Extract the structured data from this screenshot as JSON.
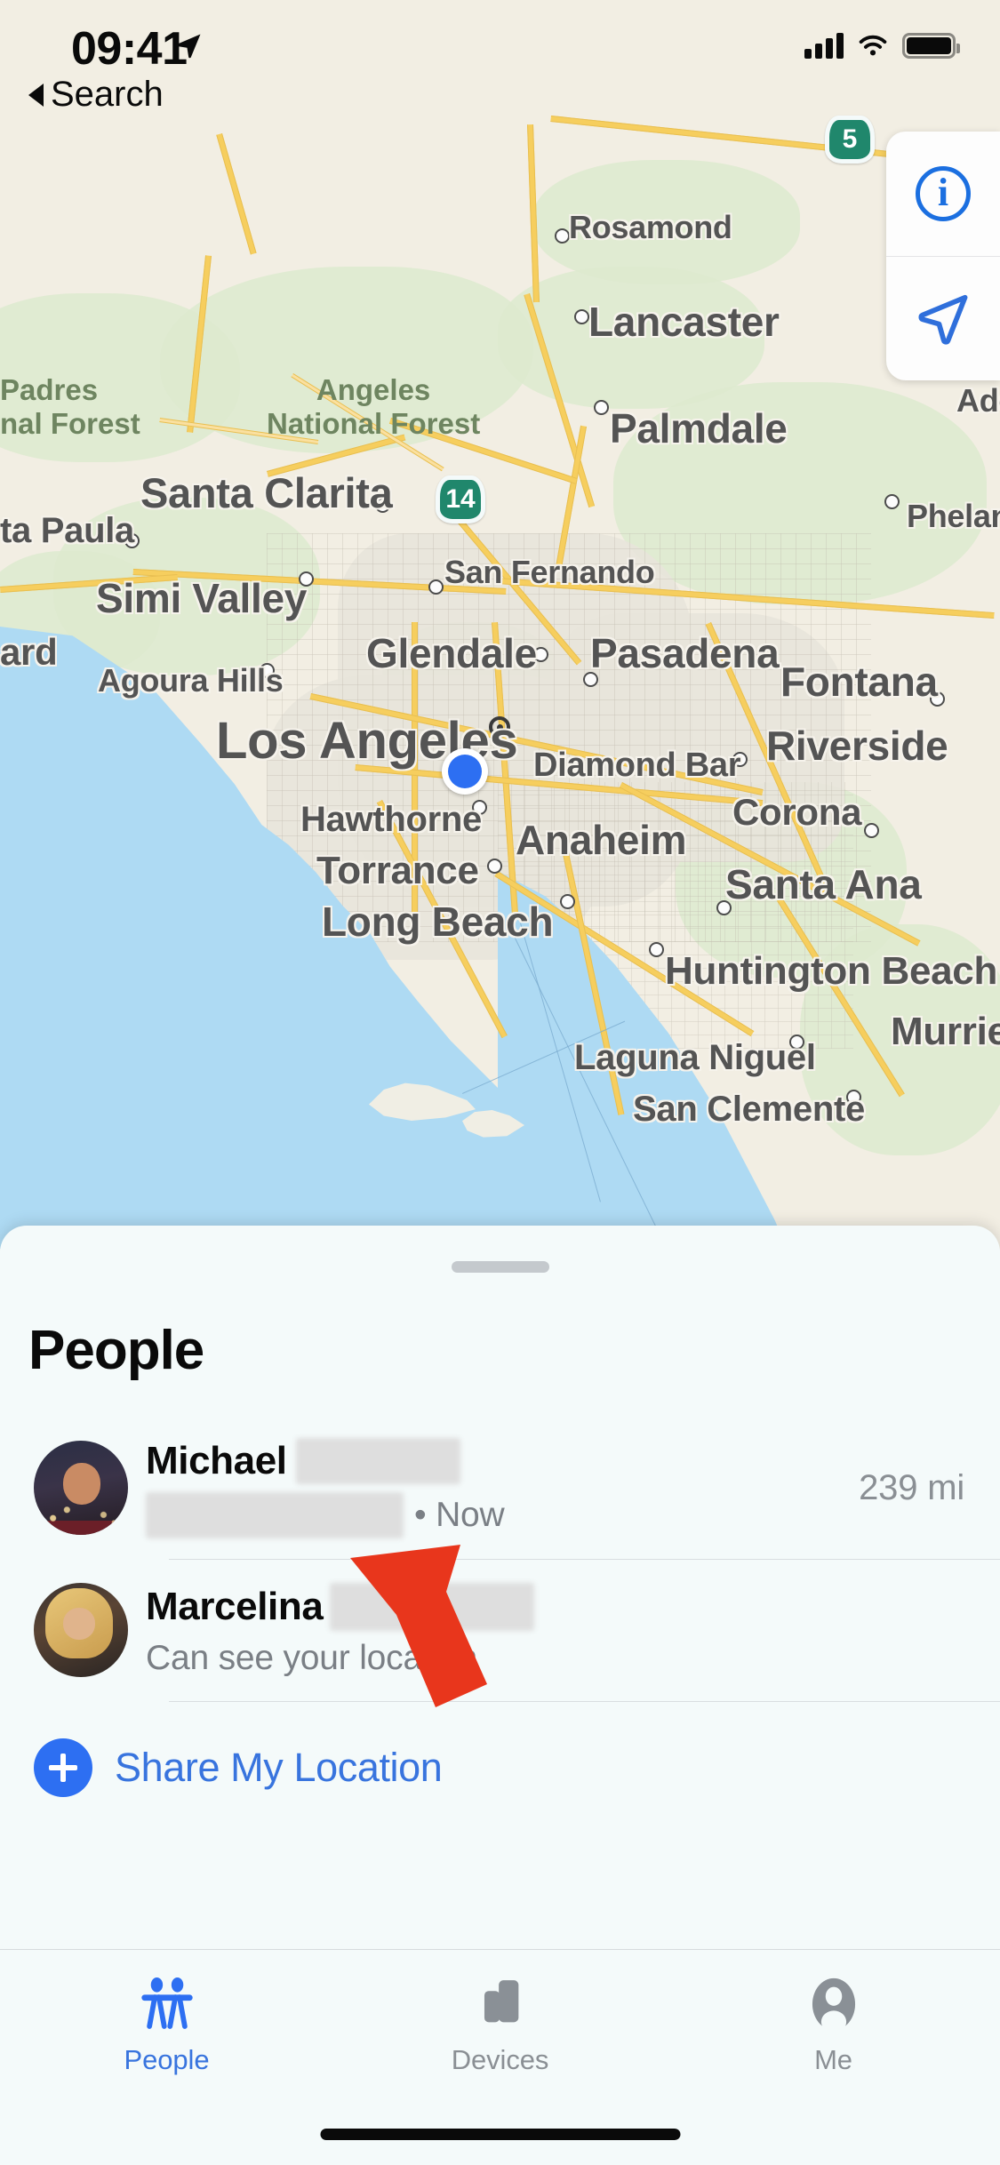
{
  "status_bar": {
    "time": "09:41",
    "location_arrow_icon": "location-arrow-icon",
    "cellular_icon": "cellular-signal-icon",
    "wifi_icon": "wifi-icon",
    "battery_icon": "battery-full-icon"
  },
  "nav": {
    "back_label": "Search",
    "back_icon": "back-caret-icon"
  },
  "map": {
    "controls": [
      {
        "name": "info-button",
        "icon": "info-circle-icon",
        "glyph": "i"
      },
      {
        "name": "tracking-button",
        "icon": "navigation-arrow-icon"
      }
    ],
    "user_location_icon": "user-location-dot",
    "highway_shields": [
      {
        "label": "14",
        "color": "#20876C"
      },
      {
        "label": "5",
        "color": "#20876C"
      }
    ],
    "city_labels": [
      "Rosamond",
      "Lancaster",
      "Palmdale",
      "Santa Clarita",
      "San Fernando",
      "Simi Valley",
      "Glendale",
      "Pasadena",
      "Fontana",
      "Phelan",
      "Los Angeles",
      "Diamond Bar",
      "Riverside",
      "Corona",
      "Hawthorne",
      "Anaheim",
      "Torrance",
      "Santa Ana",
      "Long Beach",
      "Huntington Beach",
      "Laguna Niguel",
      "San Clemente",
      "Murrie",
      "Agoura Hills",
      "ta Paula",
      "ard",
      "Ade"
    ],
    "park_labels": [
      "Padres\nnal Forest",
      "Angeles\nNational Forest"
    ]
  },
  "sheet": {
    "title": "People",
    "grabber": "sheet-grabber",
    "people": [
      {
        "first_name": "Michael",
        "last_name_redacted": true,
        "subtitle_redacted": true,
        "subtitle_suffix": "• Now",
        "distance": "239 mi",
        "avatar": "avatar-michael"
      },
      {
        "first_name": "Marcelina",
        "last_name_redacted": true,
        "subtitle": "Can see your location",
        "distance": "",
        "avatar": "avatar-marcelina"
      }
    ],
    "share_location": {
      "label": "Share My Location",
      "icon": "plus-circle-icon",
      "accent": "#3874DE"
    }
  },
  "tab_bar": {
    "active_color": "#3874DE",
    "inactive_color": "#8A8F94",
    "tabs": [
      {
        "label": "People",
        "icon": "two-people-icon",
        "active": true
      },
      {
        "label": "Devices",
        "icon": "devices-icon",
        "active": false
      },
      {
        "label": "Me",
        "icon": "person-circle-icon",
        "active": false
      }
    ]
  },
  "annotation": {
    "arrow_icon": "red-pointer-arrow",
    "color": "#E8361C"
  }
}
